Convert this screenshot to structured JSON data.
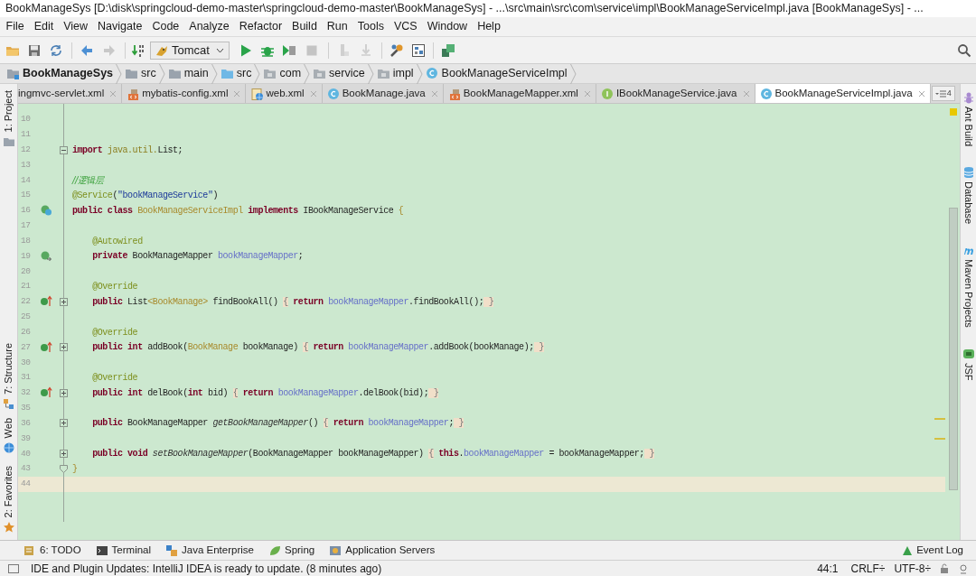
{
  "window": {
    "title": "BookManageSys [D:\\disk\\springcloud-demo-master\\springcloud-demo-master\\BookManageSys] - ...\\src\\main\\src\\com\\service\\impl\\BookManageServiceImpl.java [BookManageSys] - ..."
  },
  "menu": [
    "File",
    "Edit",
    "View",
    "Navigate",
    "Code",
    "Analyze",
    "Refactor",
    "Build",
    "Run",
    "Tools",
    "VCS",
    "Window",
    "Help"
  ],
  "toolbar": {
    "run_config": "Tomcat"
  },
  "breadcrumb": [
    {
      "label": "BookManageSys",
      "kind": "project"
    },
    {
      "label": "src",
      "kind": "folder"
    },
    {
      "label": "main",
      "kind": "folder"
    },
    {
      "label": "src",
      "kind": "source"
    },
    {
      "label": "com",
      "kind": "package"
    },
    {
      "label": "service",
      "kind": "package"
    },
    {
      "label": "impl",
      "kind": "package"
    },
    {
      "label": "BookManageServiceImpl",
      "kind": "class"
    }
  ],
  "tabs": [
    {
      "label": "ingmvc-servlet.xml",
      "kind": "none",
      "selected": false
    },
    {
      "label": "mybatis-config.xml",
      "kind": "xml",
      "selected": false
    },
    {
      "label": "web.xml",
      "kind": "web",
      "selected": false
    },
    {
      "label": "BookManage.java",
      "kind": "class",
      "selected": false
    },
    {
      "label": "BookManageMapper.xml",
      "kind": "xml",
      "selected": false
    },
    {
      "label": "IBookManageService.java",
      "kind": "interface",
      "selected": false
    },
    {
      "label": "BookManageServiceImpl.java",
      "kind": "class",
      "selected": true
    }
  ],
  "tab_overflow": "4",
  "left_tools": [
    {
      "label": "1: Project",
      "kind": "project"
    },
    {
      "label": "7: Structure",
      "kind": "structure"
    },
    {
      "label": "Web",
      "kind": "web"
    },
    {
      "label": "2: Favorites",
      "kind": "favorites"
    }
  ],
  "right_tools": [
    {
      "label": "Ant Build",
      "kind": "ant"
    },
    {
      "label": "Database",
      "kind": "database"
    },
    {
      "label": "Maven Projects",
      "kind": "maven"
    },
    {
      "label": "JSF",
      "kind": "jsf"
    }
  ],
  "code_lines": [
    {
      "n": "10",
      "current": false
    },
    {
      "n": "11",
      "current": false
    },
    {
      "n": "12",
      "fold": {
        "kind": "open"
      },
      "current": false,
      "tokens": [
        {
          "kind": "kw",
          "text": "import "
        },
        {
          "kind": "pk",
          "text": "java.util."
        },
        {
          "kind": "p",
          "text": "List;"
        }
      ]
    },
    {
      "n": "13",
      "current": false
    },
    {
      "n": "14",
      "current": false,
      "tokens": [
        {
          "kind": "c",
          "text": "//逻辑层"
        }
      ]
    },
    {
      "n": "15",
      "current": false,
      "tokens": [
        {
          "kind": "a",
          "text": "@Service"
        },
        {
          "kind": "p",
          "text": "("
        },
        {
          "kind": "s",
          "text": "\"bookManageService\""
        },
        {
          "kind": "p",
          "text": ")"
        }
      ]
    },
    {
      "n": "16",
      "gutter": {
        "kind": "bean-class"
      },
      "current": false,
      "tokens": [
        {
          "kind": "kw",
          "text": "public class "
        },
        {
          "kind": "ty",
          "text": "BookManageServiceImpl "
        },
        {
          "kind": "kw",
          "text": "implements"
        },
        {
          "kind": "p",
          "text": " IBookManageService "
        },
        {
          "kind": "ty",
          "text": "{"
        }
      ]
    },
    {
      "n": "17",
      "current": false
    },
    {
      "n": "18",
      "current": false,
      "tokens": [
        {
          "kind": "a",
          "text": "    @Autowired"
        }
      ]
    },
    {
      "n": "19",
      "gutter": {
        "kind": "bean-field"
      },
      "current": false,
      "tokens": [
        {
          "kind": "kw",
          "text": "    private"
        },
        {
          "kind": "p",
          "text": " BookManageMapper "
        },
        {
          "kind": "f",
          "text": "bookManageMapper"
        },
        {
          "kind": "p",
          "text": ";"
        }
      ]
    },
    {
      "n": "20",
      "current": false
    },
    {
      "n": "21",
      "current": false,
      "tokens": [
        {
          "kind": "a",
          "text": "    @Override"
        }
      ]
    },
    {
      "n": "22",
      "gutter": {
        "kind": "overrides"
      },
      "fold": {
        "kind": "collapsed"
      },
      "current": false,
      "tokens": [
        {
          "kind": "kw",
          "text": "    public"
        },
        {
          "kind": "p",
          "text": " List"
        },
        {
          "kind": "ty",
          "text": "<BookManage>"
        },
        {
          "kind": "p",
          "text": " findBookAll() "
        },
        {
          "kind": "b",
          "text": "{"
        },
        {
          "kind": "kw",
          "text": " return "
        },
        {
          "kind": "f",
          "text": "bookManageMapper"
        },
        {
          "kind": "p",
          "text": ".findBookAll();"
        },
        {
          "kind": "b",
          "text": " }"
        }
      ]
    },
    {
      "n": "25",
      "current": false
    },
    {
      "n": "26",
      "current": false,
      "tokens": [
        {
          "kind": "a",
          "text": "    @Override"
        }
      ]
    },
    {
      "n": "27",
      "gutter": {
        "kind": "overrides"
      },
      "fold": {
        "kind": "collapsed"
      },
      "current": false,
      "tokens": [
        {
          "kind": "kw",
          "text": "    public int"
        },
        {
          "kind": "p",
          "text": " addBook("
        },
        {
          "kind": "ty",
          "text": "BookManage"
        },
        {
          "kind": "p",
          "text": " bookManage) "
        },
        {
          "kind": "b",
          "text": "{"
        },
        {
          "kind": "kw",
          "text": " return "
        },
        {
          "kind": "f",
          "text": "bookManageMapper"
        },
        {
          "kind": "p",
          "text": ".addBook(bookManage);"
        },
        {
          "kind": "b",
          "text": " }"
        }
      ]
    },
    {
      "n": "30",
      "current": false
    },
    {
      "n": "31",
      "current": false,
      "tokens": [
        {
          "kind": "a",
          "text": "    @Override"
        }
      ]
    },
    {
      "n": "32",
      "gutter": {
        "kind": "overrides"
      },
      "fold": {
        "kind": "collapsed"
      },
      "current": false,
      "tokens": [
        {
          "kind": "kw",
          "text": "    public int"
        },
        {
          "kind": "p",
          "text": " delBook("
        },
        {
          "kind": "kw",
          "text": "int"
        },
        {
          "kind": "p",
          "text": " bid) "
        },
        {
          "kind": "b",
          "text": "{"
        },
        {
          "kind": "kw",
          "text": " return "
        },
        {
          "kind": "f",
          "text": "bookManageMapper"
        },
        {
          "kind": "p",
          "text": ".delBook(bid);"
        },
        {
          "kind": "b",
          "text": " }"
        }
      ]
    },
    {
      "n": "35",
      "current": false
    },
    {
      "n": "36",
      "fold": {
        "kind": "collapsed"
      },
      "current": false,
      "tokens": [
        {
          "kind": "kw",
          "text": "    public"
        },
        {
          "kind": "p",
          "text": " BookManageMapper "
        },
        {
          "kind": "i",
          "text": "getBookManageMapper"
        },
        {
          "kind": "p",
          "text": "() "
        },
        {
          "kind": "b",
          "text": "{"
        },
        {
          "kind": "kw",
          "text": " return "
        },
        {
          "kind": "f",
          "text": "bookManageMapper"
        },
        {
          "kind": "p",
          "text": ";"
        },
        {
          "kind": "b",
          "text": " }"
        }
      ]
    },
    {
      "n": "39",
      "current": false
    },
    {
      "n": "40",
      "fold": {
        "kind": "collapsed"
      },
      "current": false,
      "tokens": [
        {
          "kind": "kw",
          "text": "    public void "
        },
        {
          "kind": "i",
          "text": "setBookManageMapper"
        },
        {
          "kind": "p",
          "text": "(BookManageMapper bookManageMapper) "
        },
        {
          "kind": "b",
          "text": "{"
        },
        {
          "kind": "kw",
          "text": " this"
        },
        {
          "kind": "p",
          "text": "."
        },
        {
          "kind": "f",
          "text": "bookManageMapper"
        },
        {
          "kind": "p",
          "text": " = bookManageMapper;"
        },
        {
          "kind": "b",
          "text": " }"
        }
      ]
    },
    {
      "n": "43",
      "fold": {
        "kind": "end"
      },
      "current": false,
      "tokens": [
        {
          "kind": "ty",
          "text": "}"
        }
      ]
    },
    {
      "n": "44",
      "current": true
    }
  ],
  "tool_windows": [
    {
      "label": "6: TODO",
      "kind": "todo"
    },
    {
      "label": "Terminal",
      "kind": "terminal"
    },
    {
      "label": "Java Enterprise",
      "kind": "javaee"
    },
    {
      "label": "Spring",
      "kind": "spring"
    },
    {
      "label": "Application Servers",
      "kind": "servers"
    }
  ],
  "event_log": "Event Log",
  "status_bar": {
    "message": "IDE and Plugin Updates: IntelliJ IDEA is ready to update. (8 minutes ago)",
    "position": "44:1",
    "line_separator": "CRLF÷",
    "encoding": "UTF-8÷"
  }
}
